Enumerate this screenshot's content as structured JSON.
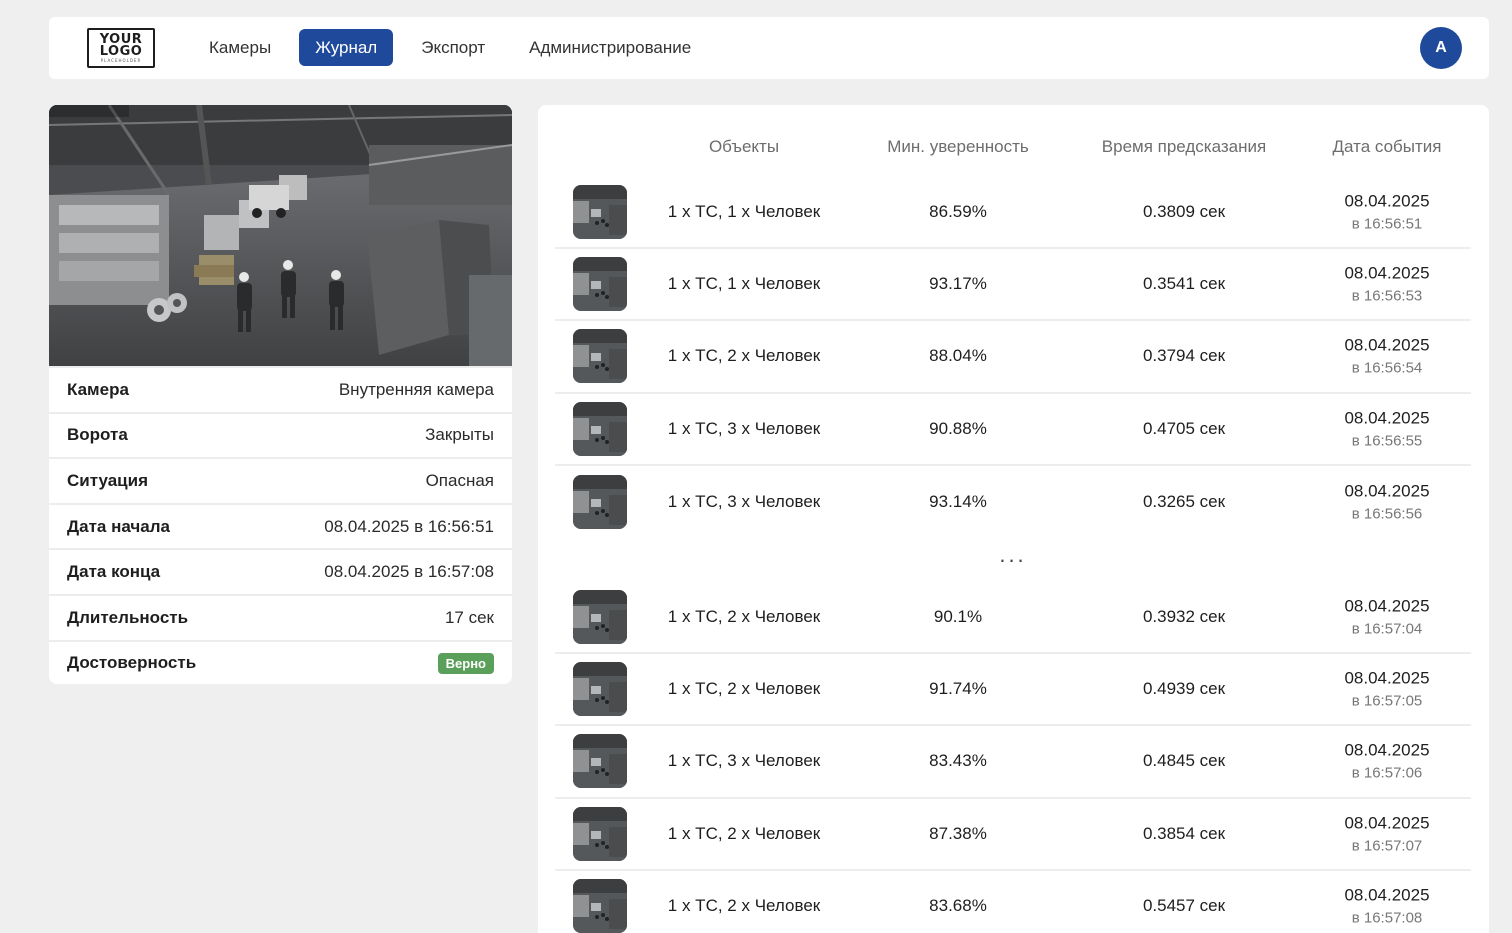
{
  "logo": {
    "line1": "YOUR",
    "line2": "LOGO",
    "line3": "PLACEHOLDER"
  },
  "nav": {
    "items": [
      {
        "label": "Камеры",
        "active": false
      },
      {
        "label": "Журнал",
        "active": true
      },
      {
        "label": "Экспорт",
        "active": false
      },
      {
        "label": "Администрирование",
        "active": false
      }
    ]
  },
  "user": {
    "avatar_letter": "A"
  },
  "event_info": {
    "rows": [
      {
        "label": "Камера",
        "value": "Внутренняя камера"
      },
      {
        "label": "Ворота",
        "value": "Закрыты"
      },
      {
        "label": "Ситуация",
        "value": "Опасная"
      },
      {
        "label": "Дата начала",
        "value": "08.04.2025 в 16:56:51"
      },
      {
        "label": "Дата конца",
        "value": "08.04.2025 в 16:57:08"
      },
      {
        "label": "Длительность",
        "value": "17 сек"
      },
      {
        "label": "Достоверность",
        "value": "Верно"
      }
    ],
    "badge_color": "#5aa05a"
  },
  "table": {
    "headers": {
      "objects": "Объекты",
      "confidence": "Мин. уверенность",
      "prediction_time": "Время предсказания",
      "event_date": "Дата события"
    },
    "rows_top": [
      {
        "objects": "1 х ТС, 1 х Человек",
        "confidence": "86.59%",
        "time": "0.3809 сек",
        "date": "08.04.2025",
        "clock": "в 16:56:51"
      },
      {
        "objects": "1 х ТС, 1 х Человек",
        "confidence": "93.17%",
        "time": "0.3541 сек",
        "date": "08.04.2025",
        "clock": "в 16:56:53"
      },
      {
        "objects": "1 х ТС, 2 х Человек",
        "confidence": "88.04%",
        "time": "0.3794 сек",
        "date": "08.04.2025",
        "clock": "в 16:56:54"
      },
      {
        "objects": "1 х ТС, 3 х Человек",
        "confidence": "90.88%",
        "time": "0.4705 сек",
        "date": "08.04.2025",
        "clock": "в 16:56:55"
      },
      {
        "objects": "1 х ТС, 3 х Человек",
        "confidence": "93.14%",
        "time": "0.3265 сек",
        "date": "08.04.2025",
        "clock": "в 16:56:56"
      }
    ],
    "ellipsis": "...",
    "rows_bottom": [
      {
        "objects": "1 х ТС, 2 х Человек",
        "confidence": "90.1%",
        "time": "0.3932 сек",
        "date": "08.04.2025",
        "clock": "в 16:57:04"
      },
      {
        "objects": "1 х ТС, 2 х Человек",
        "confidence": "91.74%",
        "time": "0.4939 сек",
        "date": "08.04.2025",
        "clock": "в 16:57:05"
      },
      {
        "objects": "1 х ТС, 3 х Человек",
        "confidence": "83.43%",
        "time": "0.4845 сек",
        "date": "08.04.2025",
        "clock": "в 16:57:06"
      },
      {
        "objects": "1 х ТС, 2 х Человек",
        "confidence": "87.38%",
        "time": "0.3854 сек",
        "date": "08.04.2025",
        "clock": "в 16:57:07"
      },
      {
        "objects": "1 х ТС, 2 х Человек",
        "confidence": "83.68%",
        "time": "0.5457 сек",
        "date": "08.04.2025",
        "clock": "в 16:57:08"
      }
    ]
  },
  "colors": {
    "accent": "#1f4a9b",
    "background": "#efefef",
    "success": "#5aa05a"
  }
}
